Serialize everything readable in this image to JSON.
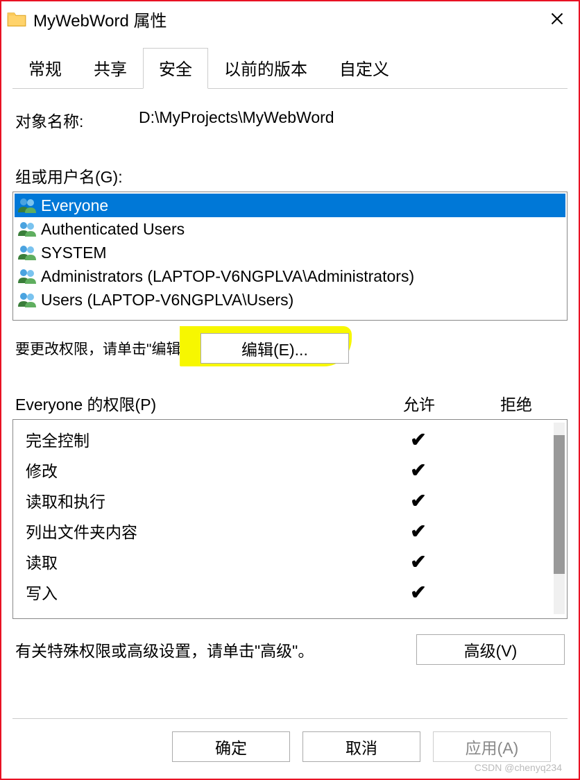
{
  "titlebar": {
    "title": "MyWebWord 属性"
  },
  "tabs": [
    {
      "label": "常规"
    },
    {
      "label": "共享"
    },
    {
      "label": "安全",
      "active": true
    },
    {
      "label": "以前的版本"
    },
    {
      "label": "自定义"
    }
  ],
  "object_name_label": "对象名称:",
  "object_name_value": "D:\\MyProjects\\MyWebWord",
  "group_label": "组或用户名(G):",
  "groups": [
    {
      "name": "Everyone",
      "selected": true
    },
    {
      "name": "Authenticated Users"
    },
    {
      "name": "SYSTEM"
    },
    {
      "name": "Administrators (LAPTOP-V6NGPLVA\\Administrators)"
    },
    {
      "name": "Users (LAPTOP-V6NGPLVA\\Users)"
    }
  ],
  "edit_hint": "要更改权限，请单击\"编辑\"。",
  "edit_button": "编辑(E)...",
  "perm_header": {
    "name": "Everyone 的权限(P)",
    "allow": "允许",
    "deny": "拒绝"
  },
  "permissions": [
    {
      "name": "完全控制",
      "allow": true,
      "deny": false
    },
    {
      "name": "修改",
      "allow": true,
      "deny": false
    },
    {
      "name": "读取和执行",
      "allow": true,
      "deny": false
    },
    {
      "name": "列出文件夹内容",
      "allow": true,
      "deny": false
    },
    {
      "name": "读取",
      "allow": true,
      "deny": false
    },
    {
      "name": "写入",
      "allow": true,
      "deny": false
    }
  ],
  "advanced_hint": "有关特殊权限或高级设置，请单击\"高级\"。",
  "advanced_button": "高级(V)",
  "footer": {
    "ok": "确定",
    "cancel": "取消",
    "apply": "应用(A)"
  },
  "watermark": "CSDN @chenyq234"
}
